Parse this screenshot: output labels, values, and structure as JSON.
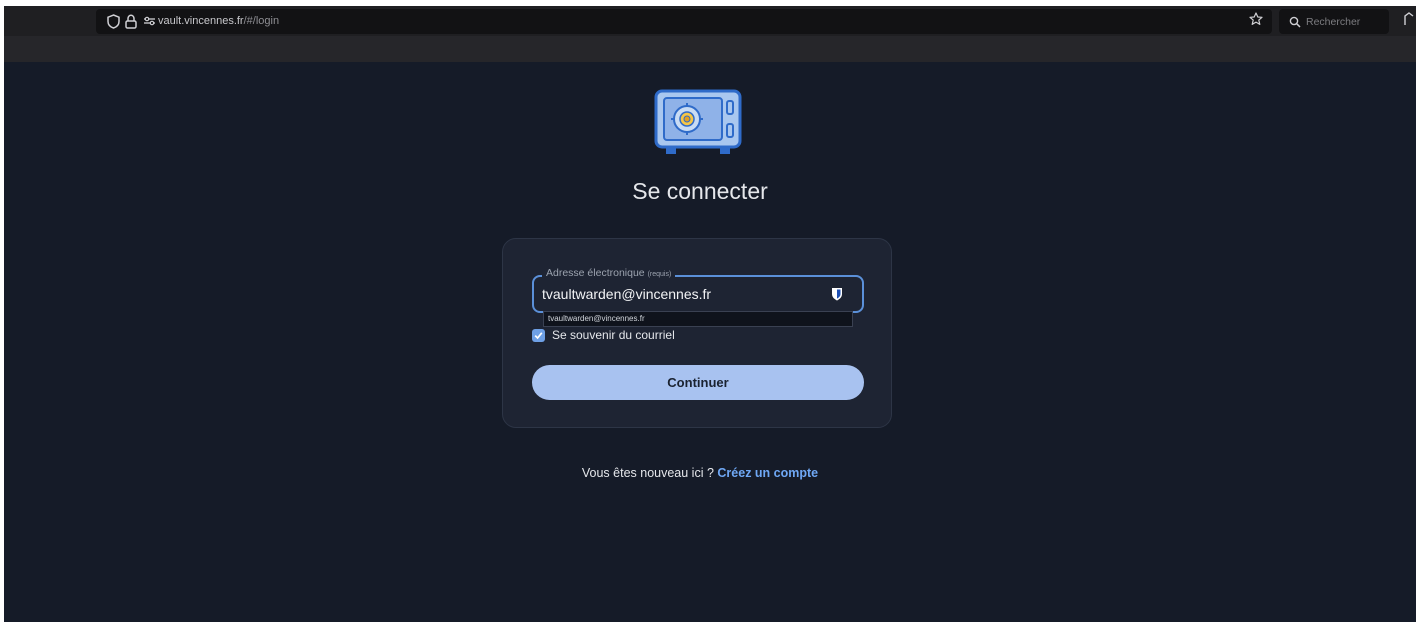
{
  "browser": {
    "url_domain": "vault.vincennes.fr",
    "url_path": "/#/login",
    "search_placeholder": "Rechercher"
  },
  "login": {
    "title": "Se connecter",
    "email_label": "Adresse électronique",
    "email_required": "(requis)",
    "email_value": "tvaultwarden@vincennes.fr",
    "autofill_suggestion": "tvaultwarden@vincennes.fr",
    "remember_label": "Se souvenir du courriel",
    "remember_checked": true,
    "continue_label": "Continuer",
    "new_here_text": "Vous êtes nouveau ici ?",
    "create_account_label": "Créez un compte"
  },
  "icons": [
    "shield-icon",
    "lock-icon",
    "permissions-icon",
    "bookmark-star-icon",
    "search-icon",
    "vault-logo",
    "bitwarden-shield-icon",
    "checkmark-icon"
  ],
  "colors": {
    "page_bg": "#151b28",
    "card_bg": "#1e2433",
    "accent": "#6fa8f5",
    "button_bg": "#a8c2f0",
    "field_border": "#5b90d9"
  }
}
